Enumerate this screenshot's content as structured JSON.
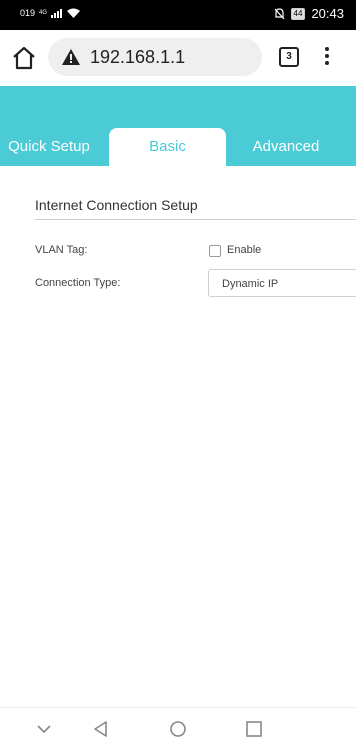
{
  "status_bar": {
    "carrier": "019",
    "network": "4G",
    "battery": "44",
    "time": "20:43"
  },
  "browser": {
    "url": "192.168.1.1",
    "tab_count": "3"
  },
  "tabs": [
    {
      "label": "Quick Setup",
      "active": false
    },
    {
      "label": "Basic",
      "active": true
    },
    {
      "label": "Advanced",
      "active": false
    }
  ],
  "section": {
    "title": "Internet Connection Setup"
  },
  "form": {
    "vlan_label": "VLAN Tag:",
    "vlan_checkbox_label": "Enable",
    "vlan_checked": false,
    "connection_type_label": "Connection Type:",
    "connection_type_value": "Dynamic IP"
  },
  "colors": {
    "accent": "#4acbd6"
  }
}
